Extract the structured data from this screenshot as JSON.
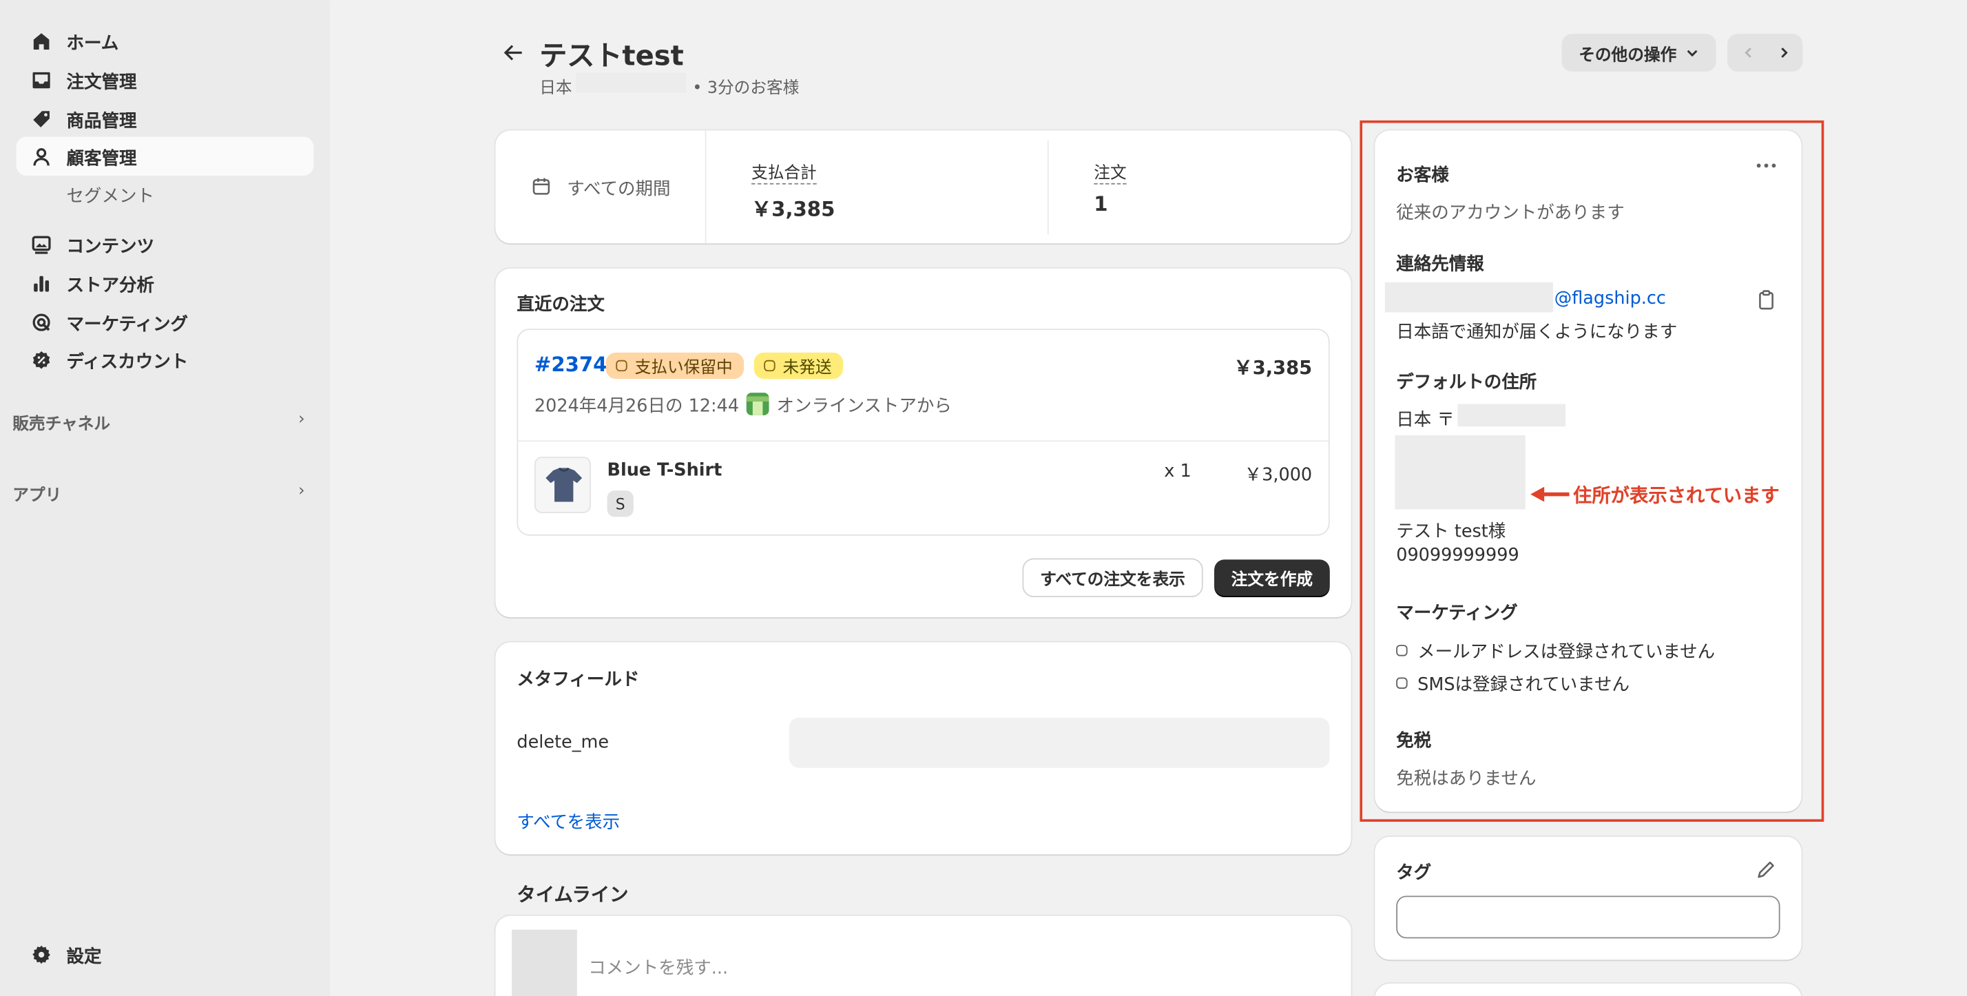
{
  "nav": {
    "items": [
      {
        "label": "ホーム",
        "icon": "home-icon"
      },
      {
        "label": "注文管理",
        "icon": "inbox-icon"
      },
      {
        "label": "商品管理",
        "icon": "tag-icon"
      },
      {
        "label": "顧客管理",
        "icon": "person-icon"
      }
    ],
    "segment": "セグメント",
    "items2": [
      {
        "label": "コンテンツ",
        "icon": "image-icon"
      },
      {
        "label": "ストア分析",
        "icon": "bar-chart-icon"
      },
      {
        "label": "マーケティング",
        "icon": "target-icon"
      },
      {
        "label": "ディスカウント",
        "icon": "discount-icon"
      }
    ],
    "sales_channels": "販売チャネル",
    "apps": "アプリ",
    "settings": "設定"
  },
  "header": {
    "title": "テストtest",
    "country": "日本",
    "meta": "• 3分のお客様",
    "more_actions": "その他の操作"
  },
  "stats": {
    "period": "すべての期間",
    "total_label": "支払合計",
    "total_value": "￥3,385",
    "orders_label": "注文",
    "orders_value": "1"
  },
  "recent_orders": {
    "title": "直近の注文",
    "order_number": "#2374",
    "payment_badge": "支払い保留中",
    "fulfillment_badge": "未発送",
    "order_total": "￥3,385",
    "order_date": "2024年4月26日の 12:44",
    "order_source": "オンラインストアから",
    "product_name": "Blue T-Shirt",
    "variant": "S",
    "quantity": "x 1",
    "product_price": "￥3,000",
    "view_all": "すべての注文を表示",
    "create_order": "注文を作成"
  },
  "metafields": {
    "title": "メタフィールド",
    "key": "delete_me",
    "view_all": "すべてを表示"
  },
  "timeline": {
    "title": "タイムライン",
    "comment_placeholder": "コメントを残す..."
  },
  "customer": {
    "title": "お客様",
    "account_status": "従来のアカウントがあります",
    "contact_title": "連絡先情報",
    "email_domain": "@flagship.cc",
    "language_note": "日本語で通知が届くようになります",
    "address_title": "デフォルトの住所",
    "address_country": "日本 〒",
    "address_name": "テスト test様",
    "phone": "09099999999",
    "marketing_title": "マーケティング",
    "email_marketing": "メールアドレスは登録されていません",
    "sms_marketing": "SMSは登録されていません",
    "tax_title": "免税",
    "tax_status": "免税はありません",
    "annotation": "住所が表示されています"
  },
  "tags": {
    "title": "タグ"
  },
  "colors": {
    "highlight": "#e0422a",
    "link": "#005bd3",
    "primary_button": "#303030",
    "badge_payment": "#ffd6a4",
    "badge_fulfillment": "#ffeb78"
  }
}
